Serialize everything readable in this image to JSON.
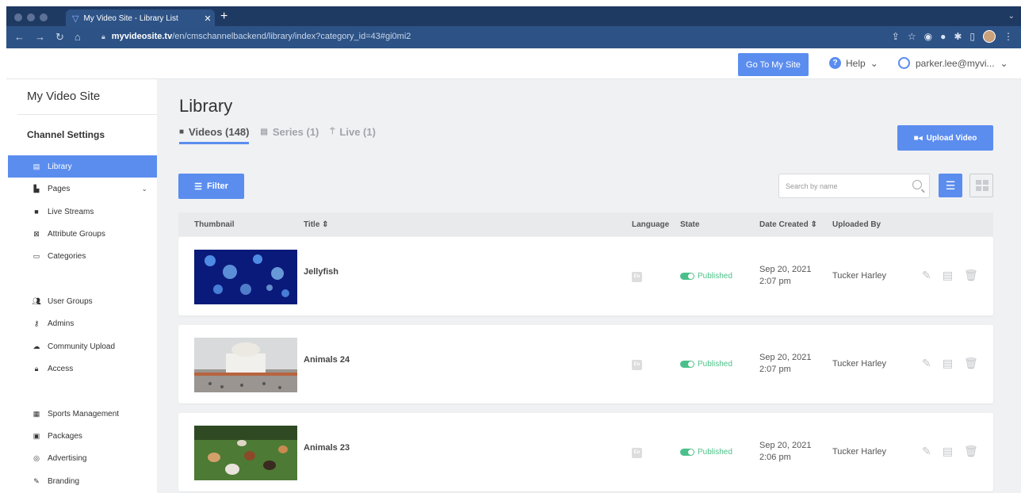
{
  "browser": {
    "tab_title": "My Video Site - Library List",
    "tab_close": "✕",
    "new_tab": "+",
    "url_host": "myvideosite.tv",
    "url_path": "/en/cmschannelbackend/library/index?category_id=43#gi0mi2"
  },
  "header": {
    "goto_label": "Go To My Site",
    "help_label": "Help",
    "user_label": "parker.lee@myvi..."
  },
  "sidebar": {
    "brand": "My Video Site",
    "section": "Channel Settings",
    "items": [
      {
        "label": "Library",
        "icon": "film-icon"
      },
      {
        "label": "Pages",
        "icon": "file-icon"
      },
      {
        "label": "Live Streams",
        "icon": "video-camera-icon"
      },
      {
        "label": "Attribute Groups",
        "icon": "attribute-icon"
      },
      {
        "label": "Categories",
        "icon": "categories-icon"
      },
      {
        "label": "User Groups",
        "icon": "users-icon"
      },
      {
        "label": "Admins",
        "icon": "key-icon"
      },
      {
        "label": "Community Upload",
        "icon": "cloud-upload-icon"
      },
      {
        "label": "Access",
        "icon": "lock-icon"
      },
      {
        "label": "Sports Management",
        "icon": "calendar-icon"
      },
      {
        "label": "Packages",
        "icon": "package-icon"
      },
      {
        "label": "Advertising",
        "icon": "eye-icon"
      },
      {
        "label": "Branding",
        "icon": "brush-icon"
      }
    ]
  },
  "main": {
    "title": "Library",
    "tabs": [
      {
        "label": "Videos (148)",
        "icon": "video-icon"
      },
      {
        "label": "Series (1)",
        "icon": "series-icon"
      },
      {
        "label": "Live (1)",
        "icon": "live-icon"
      }
    ],
    "upload_label": "Upload Video",
    "filter_label": "Filter",
    "search_placeholder": "Search by name",
    "columns": {
      "thumbnail": "Thumbnail",
      "title": "Title",
      "language": "Language",
      "state": "State",
      "date_created": "Date Created",
      "uploaded_by": "Uploaded By"
    },
    "rows": [
      {
        "title": "Jellyfish",
        "lang": "En",
        "state": "Published",
        "date": "Sep 20, 2021",
        "time": "2:07 pm",
        "uploader": "Tucker Harley"
      },
      {
        "title": "Animals 24",
        "lang": "En",
        "state": "Published",
        "date": "Sep 20, 2021",
        "time": "2:07 pm",
        "uploader": "Tucker Harley"
      },
      {
        "title": "Animals 23",
        "lang": "En",
        "state": "Published",
        "date": "Sep 20, 2021",
        "time": "2:06 pm",
        "uploader": "Tucker Harley"
      }
    ]
  },
  "colors": {
    "accent": "#5b8def",
    "published": "#4cc08a",
    "chrome_dark": "#1f3a62",
    "chrome_bar": "#2d5285"
  }
}
